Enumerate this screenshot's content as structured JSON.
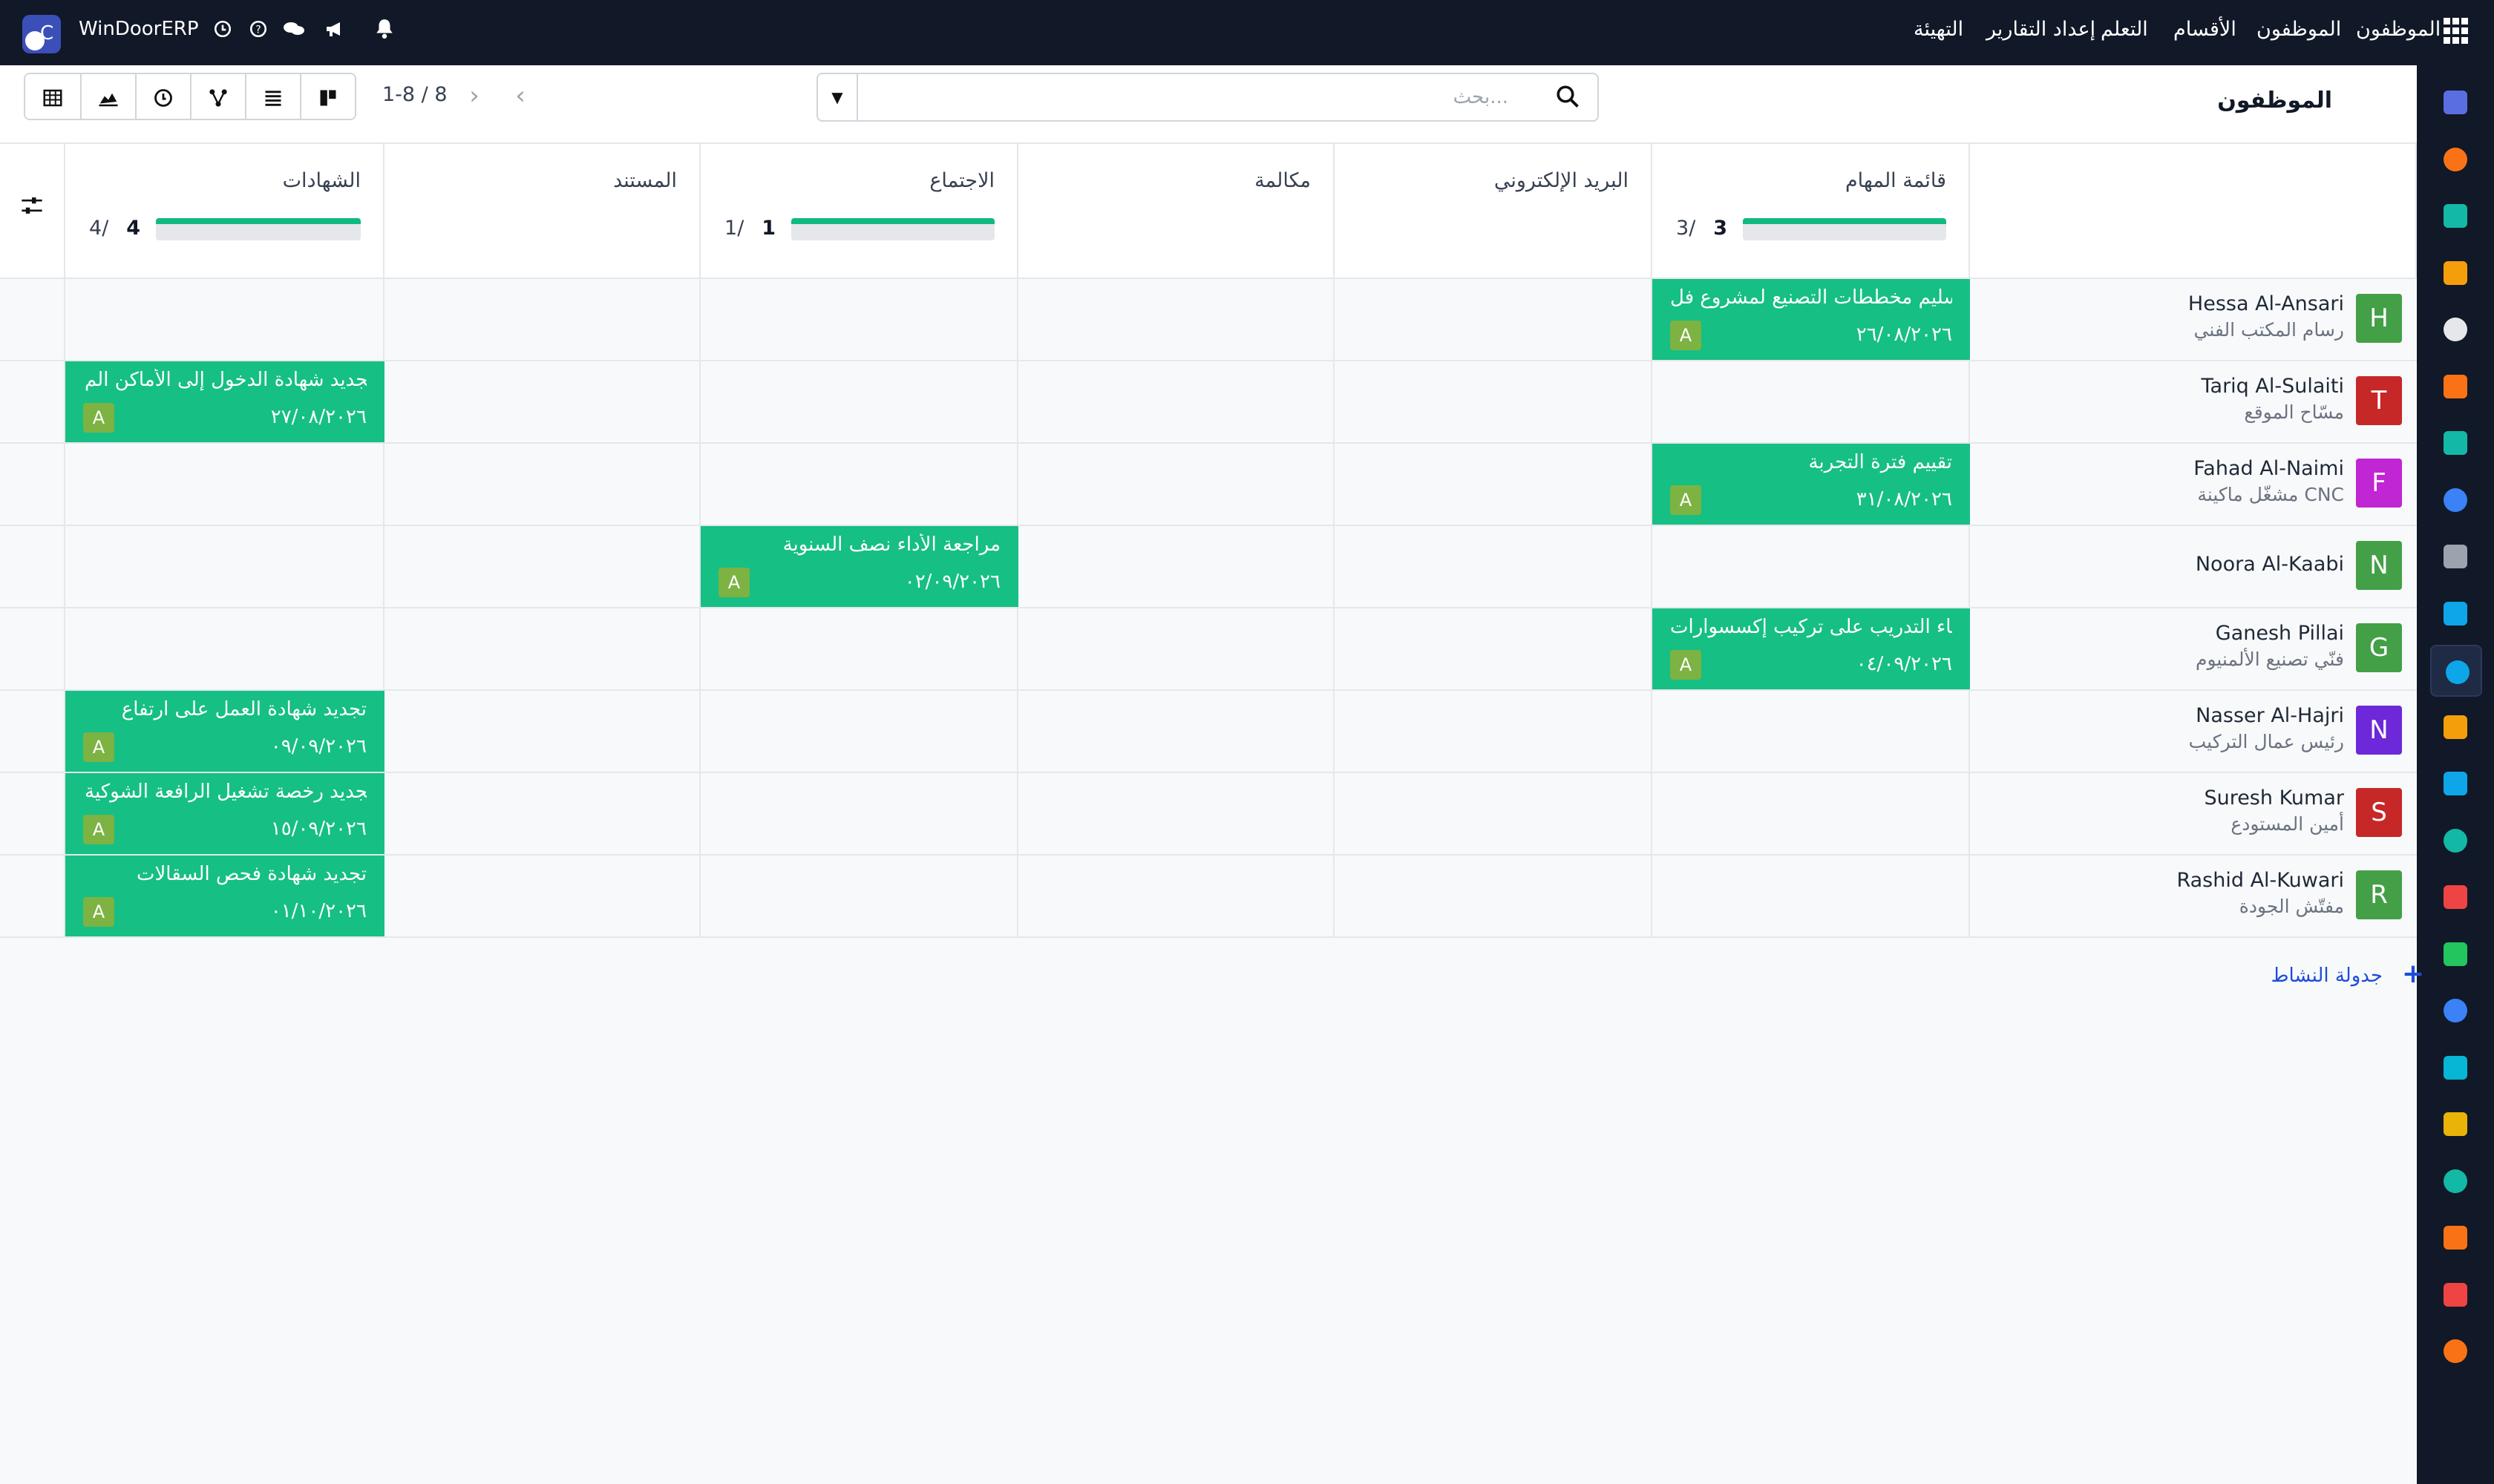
{
  "topbar": {
    "brand": "WinDoorERP",
    "nav": [
      "الموظفون",
      "الموظفون",
      "الأقسام",
      "التعلم",
      "إعداد التقارير",
      "التهيئة"
    ]
  },
  "control": {
    "page_title": "الموظفون",
    "search_placeholder": "بحث...",
    "pager": "1-8 / 8",
    "views": [
      "grid-icon",
      "area-chart-icon",
      "clock-icon",
      "hierarchy-icon",
      "list-icon",
      "kanban-icon"
    ]
  },
  "columns": [
    {
      "title": "قائمة المهام",
      "done": 3,
      "total": 3
    },
    {
      "title": "البريد الإلكتروني"
    },
    {
      "title": "مكالمة"
    },
    {
      "title": "الاجتماع",
      "done": 1,
      "total": 1
    },
    {
      "title": "المستند"
    },
    {
      "title": "الشهادات",
      "done": 4,
      "total": 4
    }
  ],
  "employees": [
    {
      "name": "Hessa Al-Ansari",
      "job": "رسام المكتب الفني",
      "initial": "H",
      "color": "#43a047"
    },
    {
      "name": "Tariq Al-Sulaiti",
      "job": "مسّاح الموقع",
      "initial": "T",
      "color": "#c62828"
    },
    {
      "name": "Fahad Al-Naimi",
      "job": "مشغّل ماكينة CNC",
      "initial": "F",
      "color": "#c026d3"
    },
    {
      "name": "Noora Al-Kaabi",
      "job": "",
      "initial": "N",
      "color": "#43a047"
    },
    {
      "name": "Ganesh Pillai",
      "job": "فنّي تصنيع الألمنيوم",
      "initial": "G",
      "color": "#43a047"
    },
    {
      "name": "Nasser Al-Hajri",
      "job": "رئيس عمال التركيب",
      "initial": "N",
      "color": "#6d28d9"
    },
    {
      "name": "Suresh Kumar",
      "job": "أمين المستودع",
      "initial": "S",
      "color": "#c62828"
    },
    {
      "name": "Rashid Al-Kuwari",
      "job": "مفتّش الجودة",
      "initial": "R",
      "color": "#43a047"
    }
  ],
  "activities": [
    {
      "row": 0,
      "col": 0,
      "summary": "تسليم مخططات التصنيع لمشروع فل...",
      "date": "٢٦/٠٨/٢٠٢٦",
      "user": "A"
    },
    {
      "row": 1,
      "col": 5,
      "summary": "تجديد شهادة الدخول إلى الأماكن الم...",
      "date": "٢٧/٠٨/٢٠٢٦",
      "user": "A"
    },
    {
      "row": 2,
      "col": 0,
      "summary": "تقييم فترة التجربة",
      "date": "٣١/٠٨/٢٠٢٦",
      "user": "A"
    },
    {
      "row": 3,
      "col": 3,
      "summary": "مراجعة الأداء نصف السنوية",
      "date": "٠٢/٠٩/٢٠٢٦",
      "user": "A"
    },
    {
      "row": 4,
      "col": 0,
      "summary": "إنهاء التدريب على تركيب إكسسوارات ...",
      "date": "٠٤/٠٩/٢٠٢٦",
      "user": "A"
    },
    {
      "row": 5,
      "col": 5,
      "summary": "تجديد شهادة العمل على ارتفاع",
      "date": "٠٩/٠٩/٢٠٢٦",
      "user": "A"
    },
    {
      "row": 6,
      "col": 5,
      "summary": "تجديد رخصة تشغيل الرافعة الشوكية",
      "date": "١٥/٠٩/٢٠٢٦",
      "user": "A"
    },
    {
      "row": 7,
      "col": 5,
      "summary": "تجديد شهادة فحص السقالات",
      "date": "٠١/١٠/٢٠٢٦",
      "user": "A"
    }
  ],
  "footer": {
    "schedule_label": "جدولة النشاط"
  },
  "rail_apps": [
    {
      "name": "mail-app-icon",
      "color": "#5b6ee1"
    },
    {
      "name": "discuss-app-icon",
      "color": "#f97316"
    },
    {
      "name": "project-app-icon",
      "color": "#14b8a6"
    },
    {
      "name": "reports-app-icon",
      "color": "#f59e0b"
    },
    {
      "name": "inventory-app-icon",
      "color": "#e5e7eb"
    },
    {
      "name": "contacts-app-icon",
      "color": "#f97316"
    },
    {
      "name": "todo-app-icon",
      "color": "#14b8a6"
    },
    {
      "name": "knowledge-app-icon",
      "color": "#3b82f6"
    },
    {
      "name": "products-app-icon",
      "color": "#9ca3af"
    },
    {
      "name": "invoicing-app-icon",
      "color": "#0ea5e9"
    },
    {
      "name": "employees-app-icon",
      "color": "#0ea5e9",
      "active": true
    },
    {
      "name": "calendar-app-icon",
      "color": "#f59e0b"
    },
    {
      "name": "sign-app-icon",
      "color": "#0ea5e9"
    },
    {
      "name": "appraisal-app-icon",
      "color": "#14b8a6"
    },
    {
      "name": "dashboard-app-icon",
      "color": "#ef4444"
    },
    {
      "name": "whatsapp-app-icon",
      "color": "#22c55e"
    },
    {
      "name": "timer-app-icon",
      "color": "#3b82f6"
    },
    {
      "name": "website-app-icon",
      "color": "#06b6d4"
    },
    {
      "name": "telegram-app-icon",
      "color": "#eab308"
    },
    {
      "name": "bank-app-icon",
      "color": "#14b8a6"
    },
    {
      "name": "studio-app-icon",
      "color": "#f97316"
    },
    {
      "name": "analytics-app-icon",
      "color": "#ef4444"
    },
    {
      "name": "settings-app-icon",
      "color": "#f97316"
    }
  ]
}
